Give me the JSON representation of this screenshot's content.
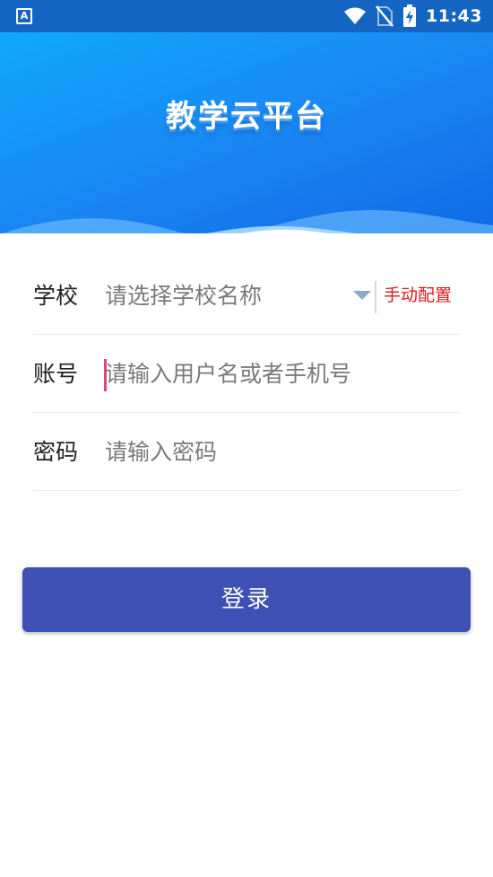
{
  "status_bar": {
    "app_badge": "A",
    "time": "11:43",
    "icons": [
      "wifi-icon",
      "no-sim-icon",
      "battery-charging-icon"
    ]
  },
  "header": {
    "title": "教学云平台"
  },
  "form": {
    "school": {
      "label": "学校",
      "placeholder": "请选择学校名称",
      "manual_config": "手动配置"
    },
    "account": {
      "label": "账号",
      "placeholder": "请输入用户名或者手机号"
    },
    "password": {
      "label": "密码",
      "placeholder": "请输入密码"
    }
  },
  "login_button": "登录",
  "colors": {
    "status_bar": "#1566c2",
    "header_gradient_start": "#10a8ff",
    "header_gradient_end": "#0e6ae6",
    "button": "#3f51b5",
    "manual_config_text": "#d91a1a",
    "cursor": "#e0457a"
  }
}
